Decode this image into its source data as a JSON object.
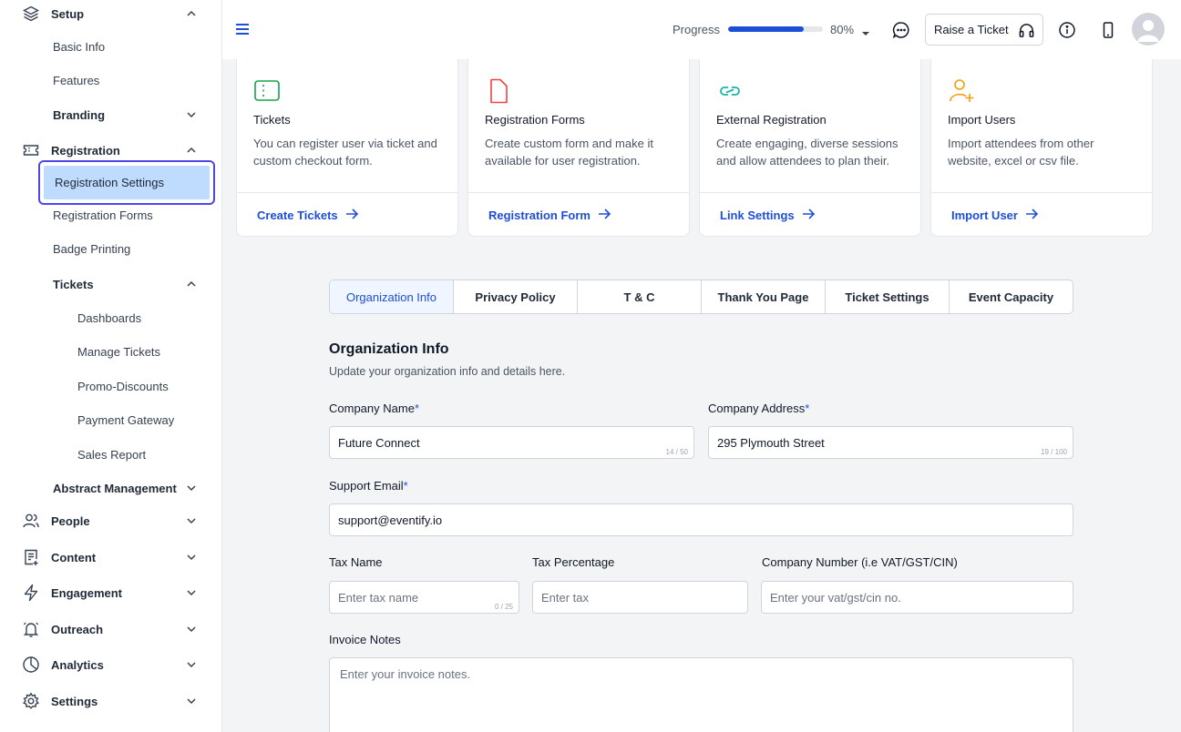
{
  "sidebar": {
    "setup": "Setup",
    "basic_info": "Basic Info",
    "features": "Features",
    "branding": "Branding",
    "registration": "Registration",
    "registration_settings": "Registration Settings",
    "registration_forms": "Registration Forms",
    "badge_printing": "Badge Printing",
    "tickets": "Tickets",
    "dashboards": "Dashboards",
    "manage_tickets": "Manage Tickets",
    "promo_discounts": "Promo-Discounts",
    "payment_gateway": "Payment Gateway",
    "sales_report": "Sales Report",
    "abstract_management": "Abstract Management",
    "people": "People",
    "content": "Content",
    "engagement": "Engagement",
    "outreach": "Outreach",
    "analytics": "Analytics",
    "settings": "Settings"
  },
  "header": {
    "progress_label": "Progress",
    "progress_value": "80%",
    "progress_fraction": 0.8,
    "raise_ticket": "Raise a Ticket"
  },
  "cards": [
    {
      "title": "Tickets",
      "desc": "You can register user via ticket and custom checkout form.",
      "link": "Create Tickets",
      "icon": "ticket-icon",
      "color": "#16a34a"
    },
    {
      "title": "Registration Forms",
      "desc": "Create custom form and make it available for user registration.",
      "link": "Registration Form",
      "icon": "document-icon",
      "color": "#ef4444"
    },
    {
      "title": "External Registration",
      "desc": "Create engaging, diverse sessions and allow attendees to plan their.",
      "link": "Link Settings",
      "icon": "link-icon",
      "color": "#14b8a6"
    },
    {
      "title": "Import Users",
      "desc": "Import attendees from other website, excel or csv file.",
      "link": "Import User",
      "icon": "user-plus-icon",
      "color": "#f59e0b"
    }
  ],
  "tabs": [
    "Organization Info",
    "Privacy Policy",
    "T & C",
    "Thank You Page",
    "Ticket Settings",
    "Event Capacity"
  ],
  "form": {
    "title": "Organization Info",
    "subtitle": "Update your organization info and details here.",
    "company_name_label": "Company Name",
    "company_name_value": "Future Connect",
    "company_name_count": "14 / 50",
    "company_address_label": "Company Address",
    "company_address_value": "295 Plymouth Street",
    "company_address_count": "19 / 100",
    "support_email_label": "Support Email",
    "support_email_value": "support@eventify.io",
    "required_mark": "*",
    "tax_name_label": "Tax Name",
    "tax_name_placeholder": "Enter tax name",
    "tax_name_count": "0 / 25",
    "tax_percentage_label": "Tax Percentage",
    "tax_percentage_placeholder": "Enter tax",
    "company_number_label": "Company Number (i.e VAT/GST/CIN)",
    "company_number_placeholder": "Enter your vat/gst/cin no.",
    "invoice_notes_label": "Invoice Notes",
    "invoice_notes_placeholder": "Enter your invoice notes."
  },
  "colors": {
    "accent": "#1d4ed8",
    "active_outline": "#4f46e5",
    "active_fill": "#bfdbfe"
  }
}
